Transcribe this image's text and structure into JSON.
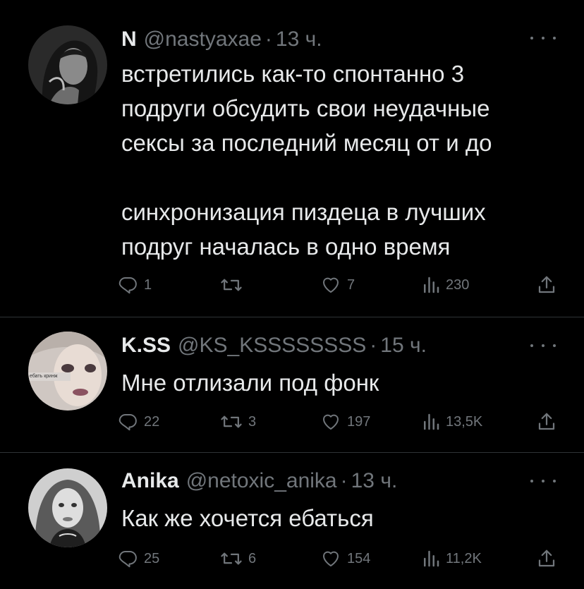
{
  "tweets": [
    {
      "name": "N",
      "handle": "@nastyaxae",
      "separator": "·",
      "time": "13 ч.",
      "text_lines": [
        "встретились как-то спонтанно 3",
        "подруги обсудить свои неудачные",
        "сексы за последний месяц от и до",
        "",
        "синхронизация пиздеца в лучших",
        "подруг началась в одно время"
      ],
      "replies": "1",
      "retweets": "",
      "likes": "7",
      "views": "230"
    },
    {
      "name": "K.SS",
      "handle": "@KS_KSSSSSSSS",
      "separator": "·",
      "time": "15 ч.",
      "avatar_caption": "ебать кринж",
      "text_lines": [
        "Мне отлизали под фонк"
      ],
      "replies": "22",
      "retweets": "3",
      "likes": "197",
      "views": "13,5K"
    },
    {
      "name": "Anika",
      "handle": "@netoxic_anika",
      "separator": "·",
      "time": "13 ч.",
      "text_lines": [
        "Как же хочется ебаться"
      ],
      "replies": "25",
      "retweets": "6",
      "likes": "154",
      "views": "11,2K"
    }
  ],
  "icons": {
    "reply": "reply-icon",
    "retweet": "retweet-icon",
    "like": "heart-icon",
    "views": "views-icon",
    "share": "share-icon",
    "more": "more-icon"
  },
  "colors": {
    "background": "#000000",
    "text": "#e7e9ea",
    "secondary": "#71767b",
    "divider": "#2f3336"
  }
}
